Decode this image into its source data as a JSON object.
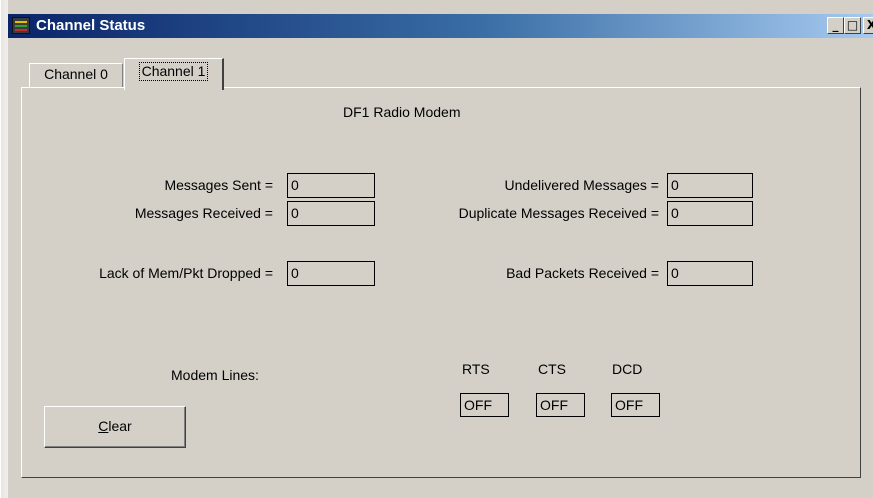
{
  "window": {
    "title": "Channel Status"
  },
  "titlebar_buttons": {
    "minimize": "_",
    "maximize": "□",
    "close": "X"
  },
  "tabs": [
    {
      "label": "Channel 0",
      "selected": false
    },
    {
      "label": "Channel 1",
      "selected": true
    }
  ],
  "panel": {
    "heading": "DF1 Radio Modem",
    "left_stats": [
      {
        "label": "Messages Sent =",
        "value": "0"
      },
      {
        "label": "Messages Received =",
        "value": "0"
      },
      {
        "label": "Lack of Mem/Pkt Dropped =",
        "value": "0"
      }
    ],
    "right_stats": [
      {
        "label": "Undelivered Messages =",
        "value": "0"
      },
      {
        "label": "Duplicate Messages Received =",
        "value": "0"
      },
      {
        "label": "Bad Packets Received =",
        "value": "0"
      }
    ],
    "modem_lines": {
      "label": "Modem Lines:",
      "lines": [
        {
          "name": "RTS",
          "status": "OFF"
        },
        {
          "name": "CTS",
          "status": "OFF"
        },
        {
          "name": "DCD",
          "status": "OFF"
        }
      ]
    },
    "clear_button": {
      "mnemonic": "C",
      "rest": "lear"
    }
  }
}
